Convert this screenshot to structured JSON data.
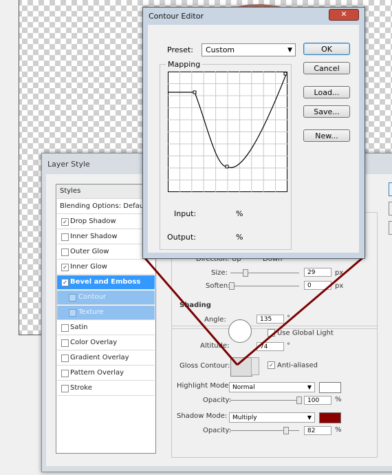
{
  "contour_editor": {
    "title": "Contour Editor",
    "close_glyph": "✕",
    "preset_label": "Preset:",
    "preset_value": "Custom",
    "mapping_label": "Mapping",
    "input_label": "Input:",
    "input_unit": "%",
    "output_label": "Output:",
    "output_unit": "%",
    "buttons": {
      "ok": "OK",
      "cancel": "Cancel",
      "load": "Load...",
      "save": "Save...",
      "new": "New..."
    }
  },
  "layer_style": {
    "title": "Layer Style",
    "styles_header": "Styles",
    "blending": "Blending Options: Default",
    "items": [
      {
        "label": "Drop Shadow",
        "checked": true
      },
      {
        "label": "Inner Shadow",
        "checked": false
      },
      {
        "label": "Outer Glow",
        "checked": false
      },
      {
        "label": "Inner Glow",
        "checked": true
      },
      {
        "label": "Bevel and Emboss",
        "checked": true
      },
      {
        "label": "Contour",
        "checked": false
      },
      {
        "label": "Texture",
        "checked": false
      },
      {
        "label": "Satin",
        "checked": false
      },
      {
        "label": "Color Overlay",
        "checked": false
      },
      {
        "label": "Gradient Overlay",
        "checked": false
      },
      {
        "label": "Pattern Overlay",
        "checked": false
      },
      {
        "label": "Stroke",
        "checked": false
      }
    ],
    "structure": {
      "direction_label": "Direction:",
      "up_label": "Up",
      "down_label": "Down",
      "size_label": "Size:",
      "size_value": "29",
      "size_unit": "px",
      "soften_label": "Soften:",
      "soften_value": "0",
      "soften_unit": "px"
    },
    "shading": {
      "title": "Shading",
      "angle_label": "Angle:",
      "angle_value": "135",
      "angle_unit": "°",
      "global_light_label": "Use Global Light",
      "altitude_label": "Altitude:",
      "altitude_value": "74",
      "altitude_unit": "°",
      "gloss_contour_label": "Gloss Contour:",
      "antialiased_label": "Anti-aliased",
      "highlight_mode_label": "Highlight Mode:",
      "highlight_mode": "Normal",
      "highlight_opacity_label": "Opacity:",
      "highlight_opacity": "100",
      "shadow_mode_label": "Shadow Mode:",
      "shadow_mode": "Multiply",
      "shadow_opacity_label": "Opacity:",
      "shadow_opacity": "82",
      "percent": "%",
      "highlight_color": "#ffffff",
      "shadow_color": "#8b0000"
    }
  }
}
